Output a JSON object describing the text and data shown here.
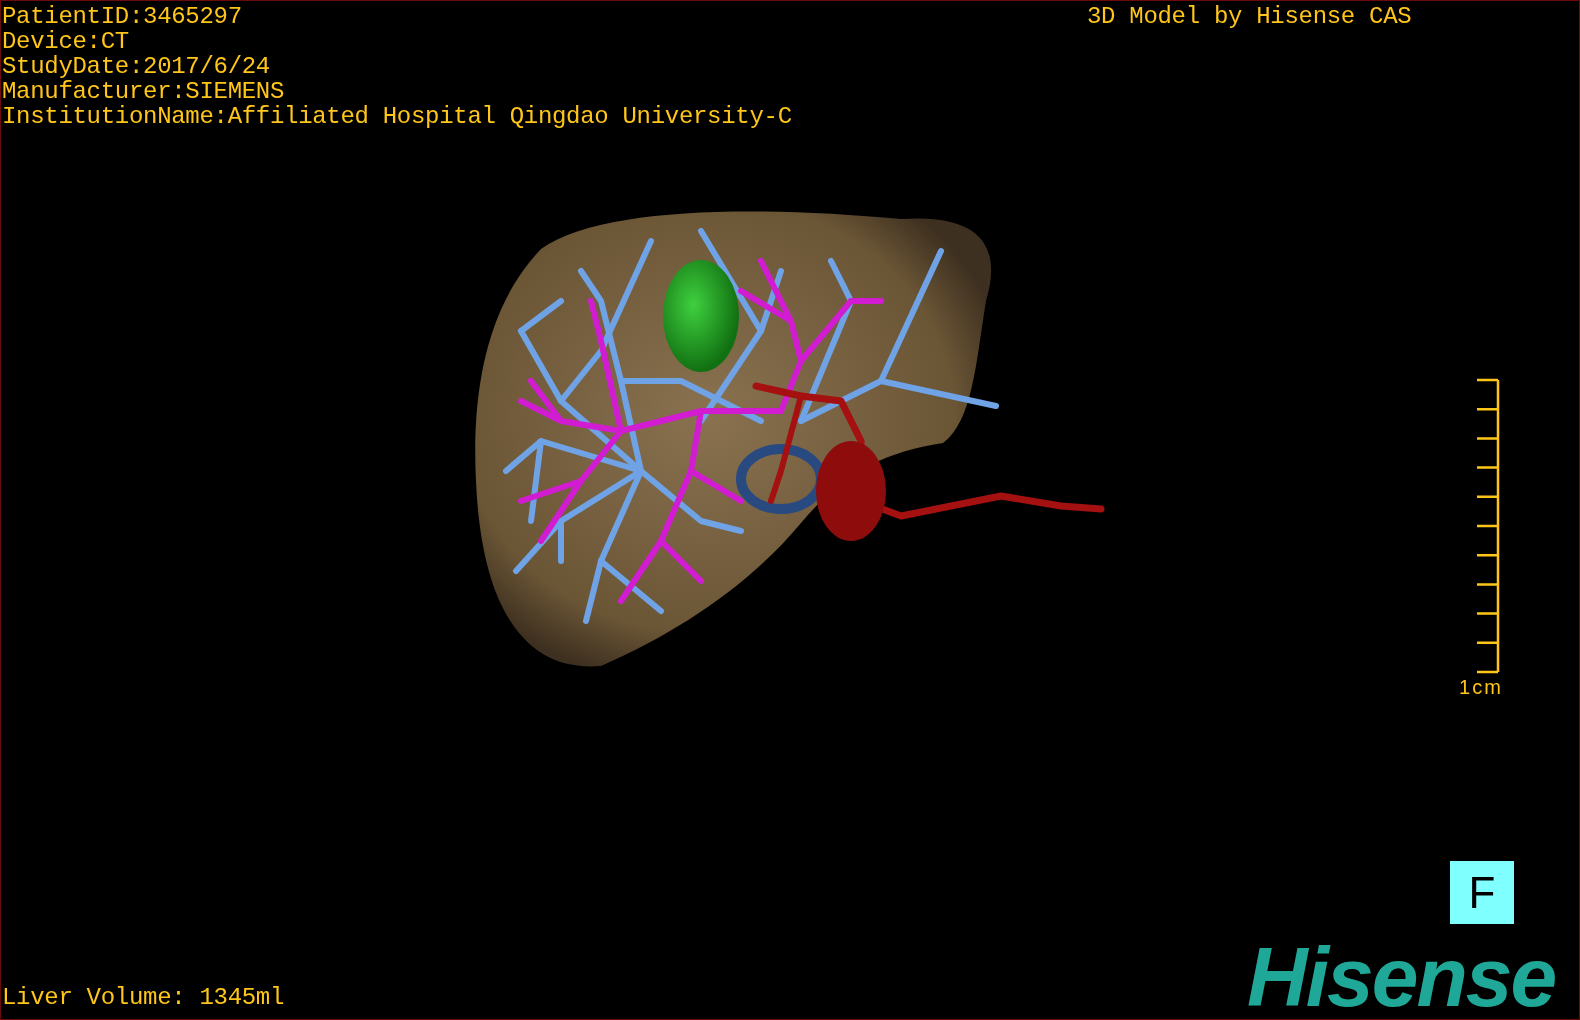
{
  "info_lines": [
    "PatientID:3465297",
    "Device:CT",
    "StudyDate:2017/6/24",
    "Manufacturer:SIEMENS",
    "InstitutionName:Affiliated Hospital Qingdao University-C"
  ],
  "title": "3D Model by Hisense CAS",
  "scale_label": "1cm",
  "orientation": "F",
  "volume": "Liver Volume: 1345ml",
  "logo": "Hisense"
}
